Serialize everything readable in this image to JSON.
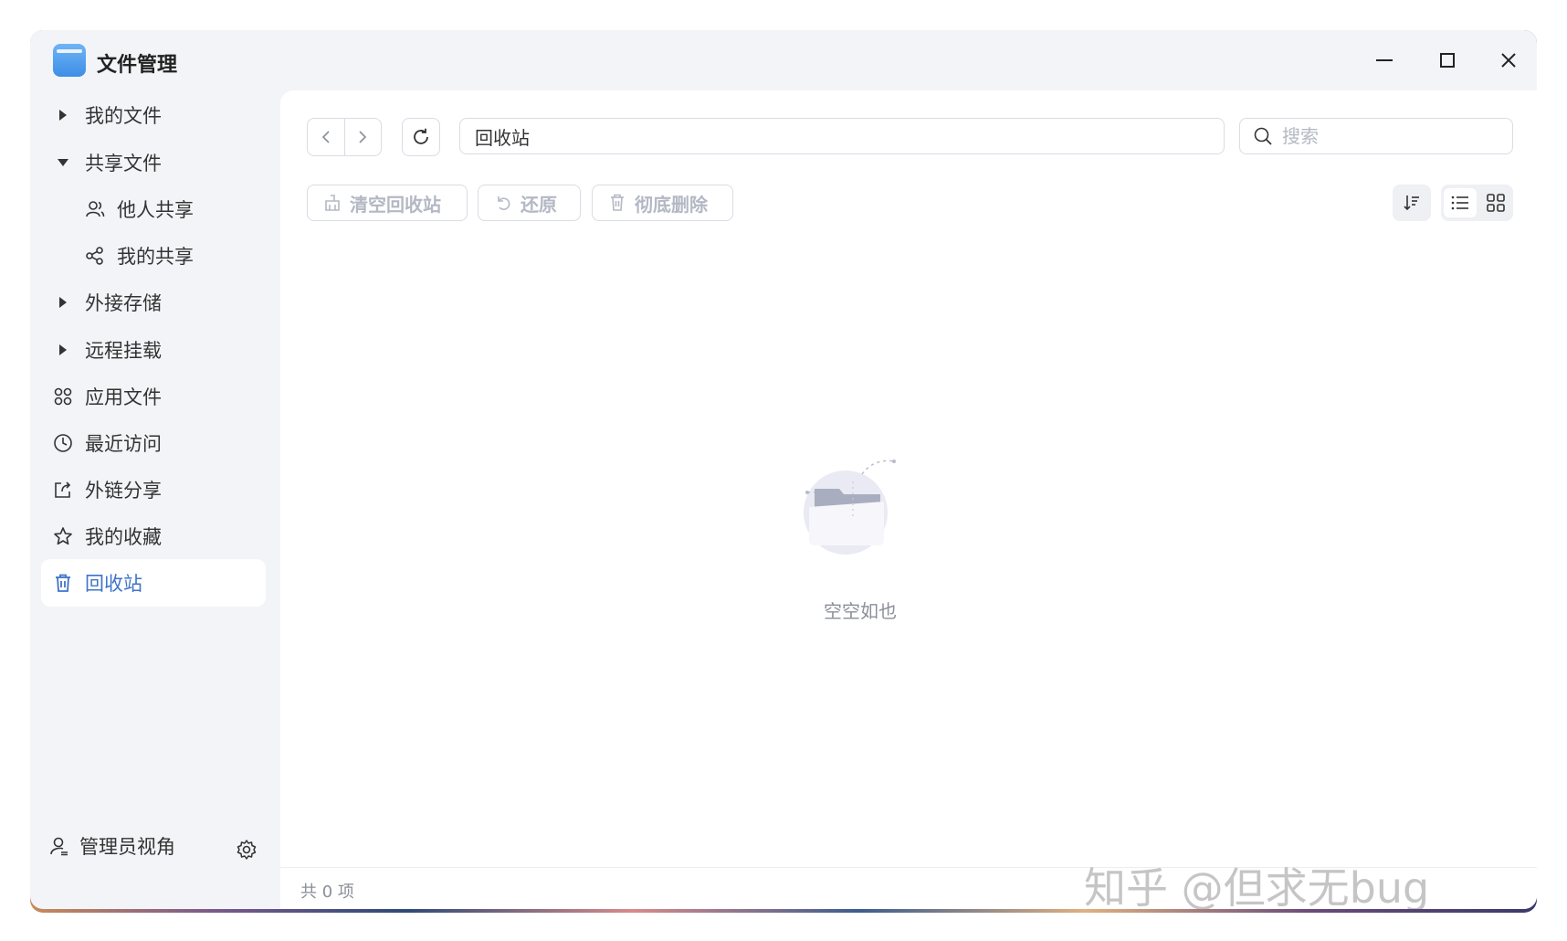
{
  "app": {
    "title": "文件管理"
  },
  "sidebar": {
    "items": [
      {
        "label": "我的文件",
        "icon": "caret-right-icon"
      },
      {
        "label": "共享文件",
        "icon": "caret-down-icon"
      },
      {
        "label": "他人共享",
        "icon": "people-icon"
      },
      {
        "label": "我的共享",
        "icon": "share-icon"
      },
      {
        "label": "外接存储",
        "icon": "caret-right-icon"
      },
      {
        "label": "远程挂载",
        "icon": "caret-right-icon"
      },
      {
        "label": "应用文件",
        "icon": "apps-icon"
      },
      {
        "label": "最近访问",
        "icon": "clock-icon"
      },
      {
        "label": "外链分享",
        "icon": "external-share-icon"
      },
      {
        "label": "我的收藏",
        "icon": "star-icon"
      },
      {
        "label": "回收站",
        "icon": "trash-icon",
        "active": true
      }
    ],
    "footer": {
      "admin_label": "管理员视角"
    }
  },
  "toolbar": {
    "path": "回收站",
    "search_placeholder": "搜索",
    "empty_trash": "清空回收站",
    "restore": "还原",
    "delete_permanently": "彻底删除"
  },
  "content": {
    "empty_text": "空空如也"
  },
  "status": {
    "count_text": "共 0 项",
    "watermark": "知乎 @但求无bug"
  },
  "colors": {
    "accent": "#3f73c9",
    "window_bg": "#f3f4f8",
    "disabled_text": "#b3b8c4"
  }
}
